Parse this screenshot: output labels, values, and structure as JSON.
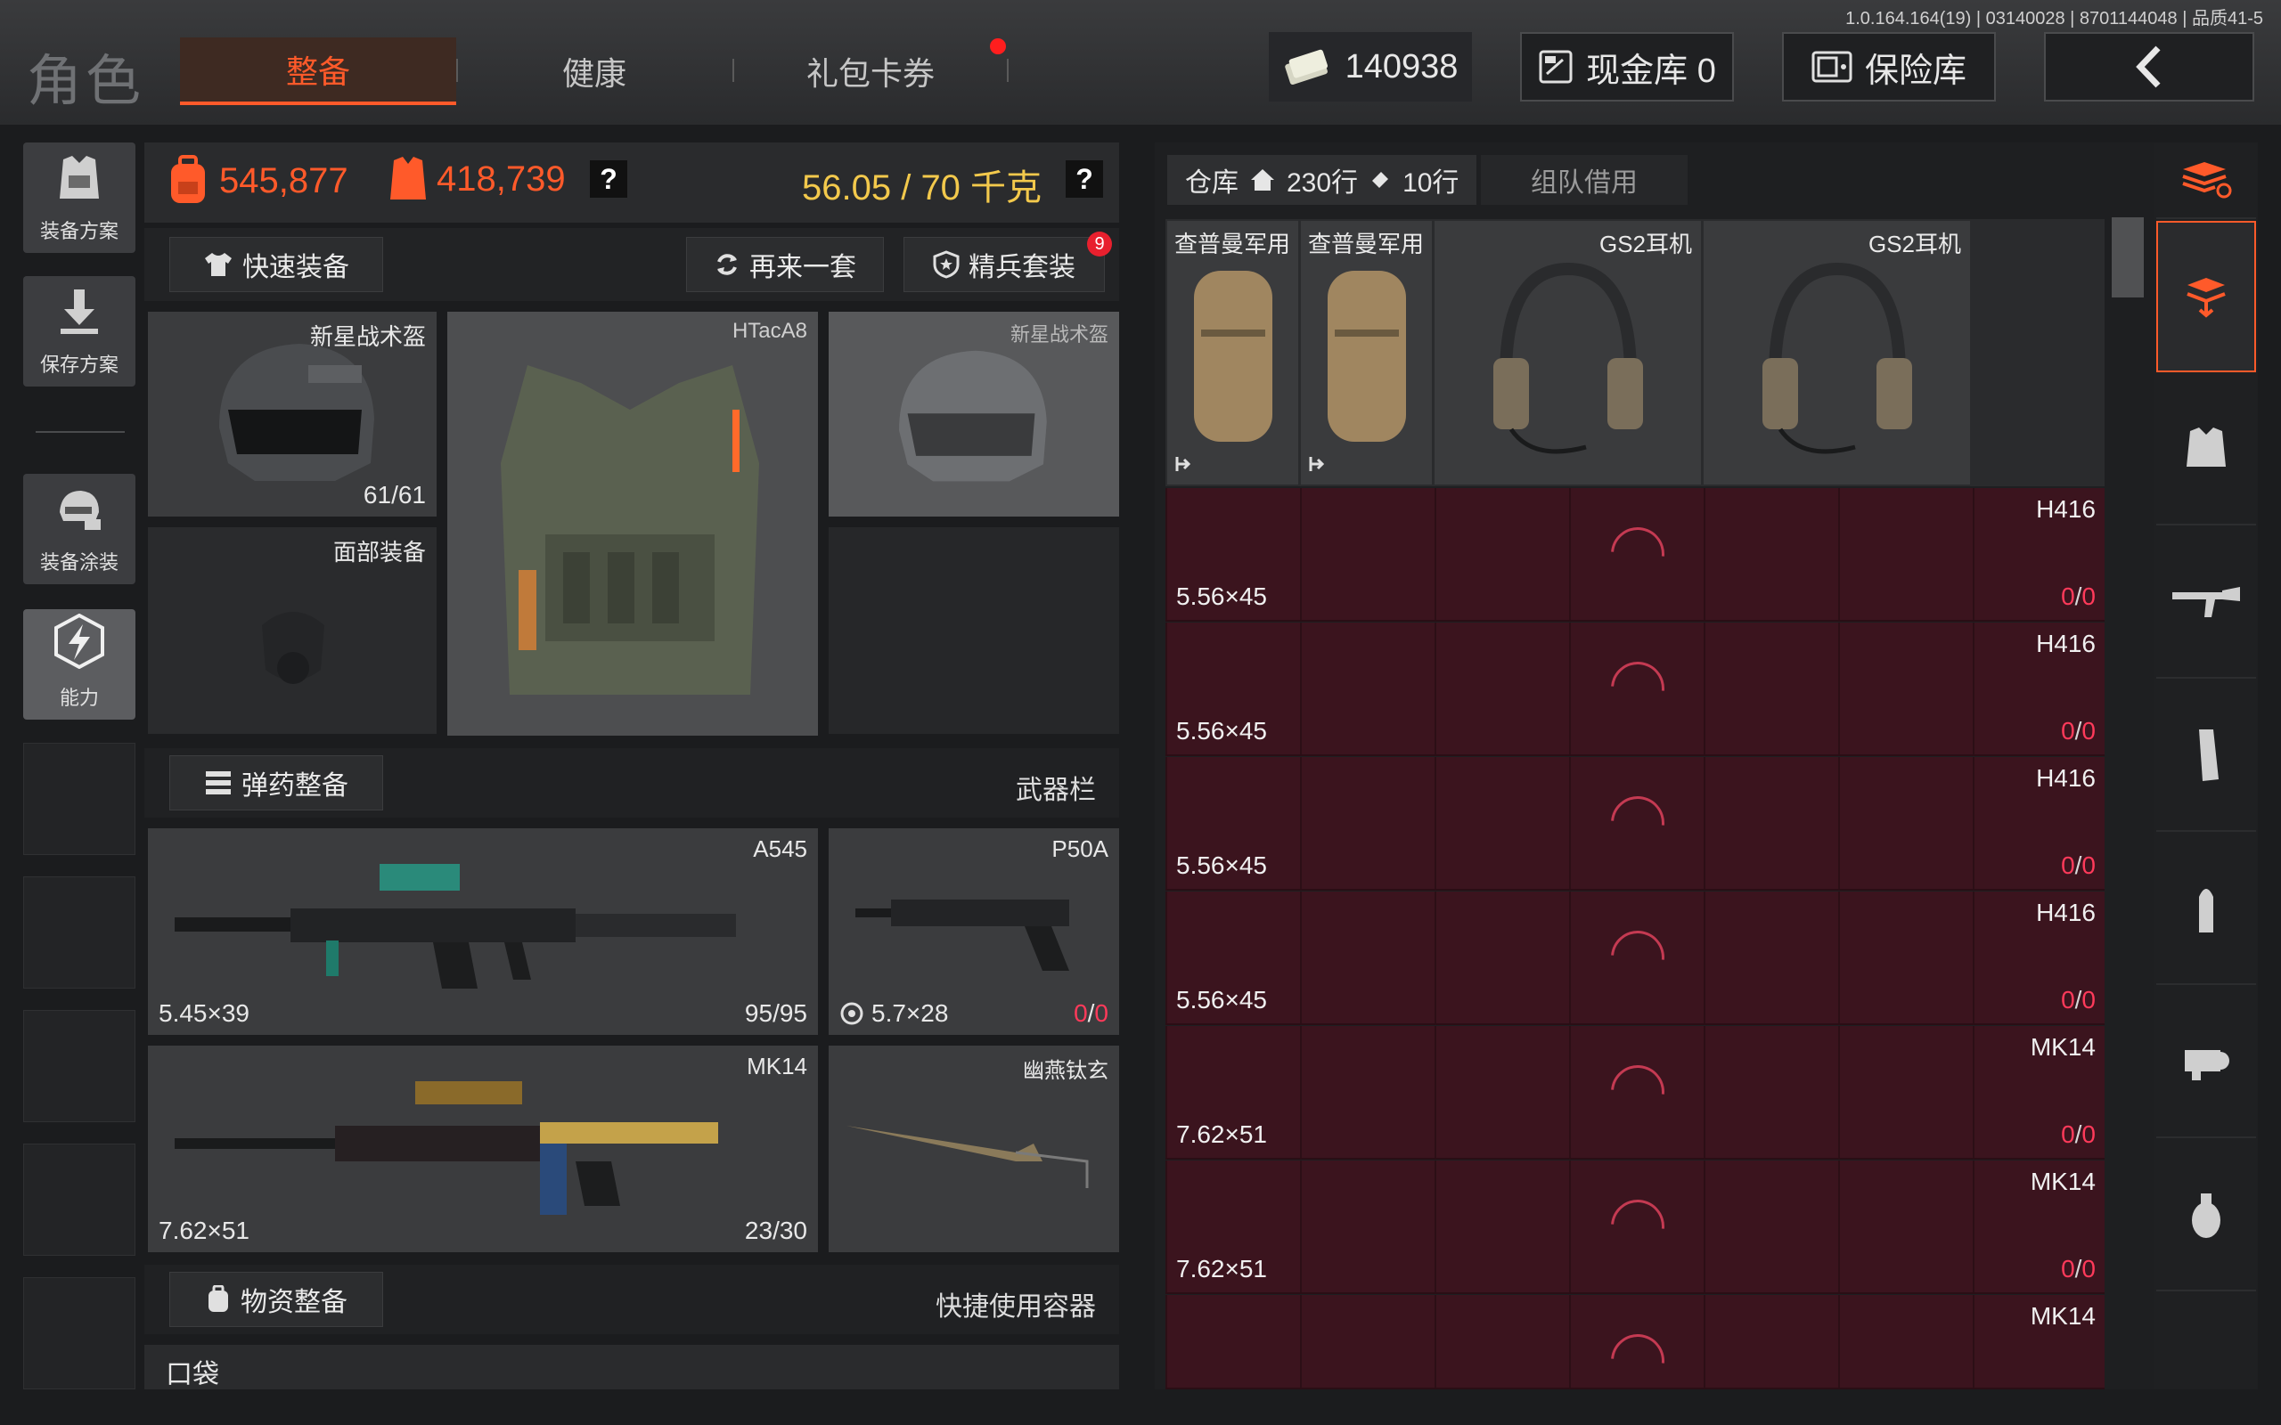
{
  "version": "1.0.164.164(19) | 03140028 | 8701144048 | 品质41-5",
  "header": {
    "title": "角色",
    "tabs": [
      {
        "label": "整备",
        "active": true
      },
      {
        "label": "健康",
        "active": false
      },
      {
        "label": "礼包卡券",
        "active": false
      }
    ],
    "money": "140938",
    "cash_vault": "现金库 0",
    "safe": "保险库",
    "back_icon": "chevron-left-icon"
  },
  "sidebar": {
    "buttons": [
      {
        "label": "装备方案",
        "icon": "vest-icon"
      },
      {
        "label": "保存方案",
        "icon": "download-icon"
      },
      {
        "label": "装备涂装",
        "icon": "helmet-paint-icon"
      },
      {
        "label": "能力",
        "icon": "lightning-icon"
      }
    ]
  },
  "stats": {
    "backpack_value": "545,877",
    "armor_value": "418,739",
    "weight": "56.05 / 70 千克",
    "help": "?"
  },
  "actions": {
    "quick_equip": "快速装备",
    "again": "再来一套",
    "elite": "精兵套装",
    "elite_badge": "9"
  },
  "gear": {
    "helmet": {
      "name": "新星战术盔",
      "durability": "61/61"
    },
    "face": {
      "name": "面部装备"
    },
    "vest": {
      "name": "HTacA8"
    },
    "helmet_ghost": {
      "name": "新星战术盔"
    }
  },
  "ammo_section": {
    "label": "弹药整备",
    "right": "武器栏"
  },
  "weapons": [
    {
      "name": "A545",
      "caliber": "5.45×39",
      "ammo": "95/95"
    },
    {
      "name": "P50A",
      "caliber": "5.7×28",
      "ammo_current": "0",
      "ammo_max": "0"
    },
    {
      "name": "MK14",
      "caliber": "7.62×51",
      "ammo": "23/30"
    },
    {
      "name": "幽燕钛玄"
    }
  ],
  "supplies_section": {
    "label": "物资整备",
    "right": "快捷使用容器"
  },
  "pocket": {
    "label": "口袋"
  },
  "warehouse": {
    "tab_label": "仓库",
    "rows_label": "230行",
    "tickets_label": "10行",
    "team_borrow": "组队借用",
    "items": [
      {
        "name": "查普曼军用"
      },
      {
        "name": "查普曼军用"
      },
      {
        "name": "GS2耳机"
      },
      {
        "name": "GS2耳机"
      }
    ],
    "ammo_rows": [
      {
        "weapon": "H416",
        "caliber": "5.56×45",
        "current": "0",
        "max": "0"
      },
      {
        "weapon": "H416",
        "caliber": "5.56×45",
        "current": "0",
        "max": "0"
      },
      {
        "weapon": "H416",
        "caliber": "5.56×45",
        "current": "0",
        "max": "0"
      },
      {
        "weapon": "H416",
        "caliber": "5.56×45",
        "current": "0",
        "max": "0"
      },
      {
        "weapon": "MK14",
        "caliber": "7.62×51",
        "current": "0",
        "max": "0"
      },
      {
        "weapon": "MK14",
        "caliber": "7.62×51",
        "current": "0",
        "max": "0"
      },
      {
        "weapon": "MK14"
      }
    ]
  },
  "categories": [
    "stack-refresh-icon",
    "stack-download-icon",
    "armor-icon",
    "rifle-icon",
    "magazine-icon",
    "bullet-icon",
    "scope-icon",
    "grenade-icon"
  ],
  "colors": {
    "accent": "#ff5a2a",
    "gold": "#f3c94c",
    "alert": "#ff3a5a",
    "row_bg": "#3b141e"
  }
}
